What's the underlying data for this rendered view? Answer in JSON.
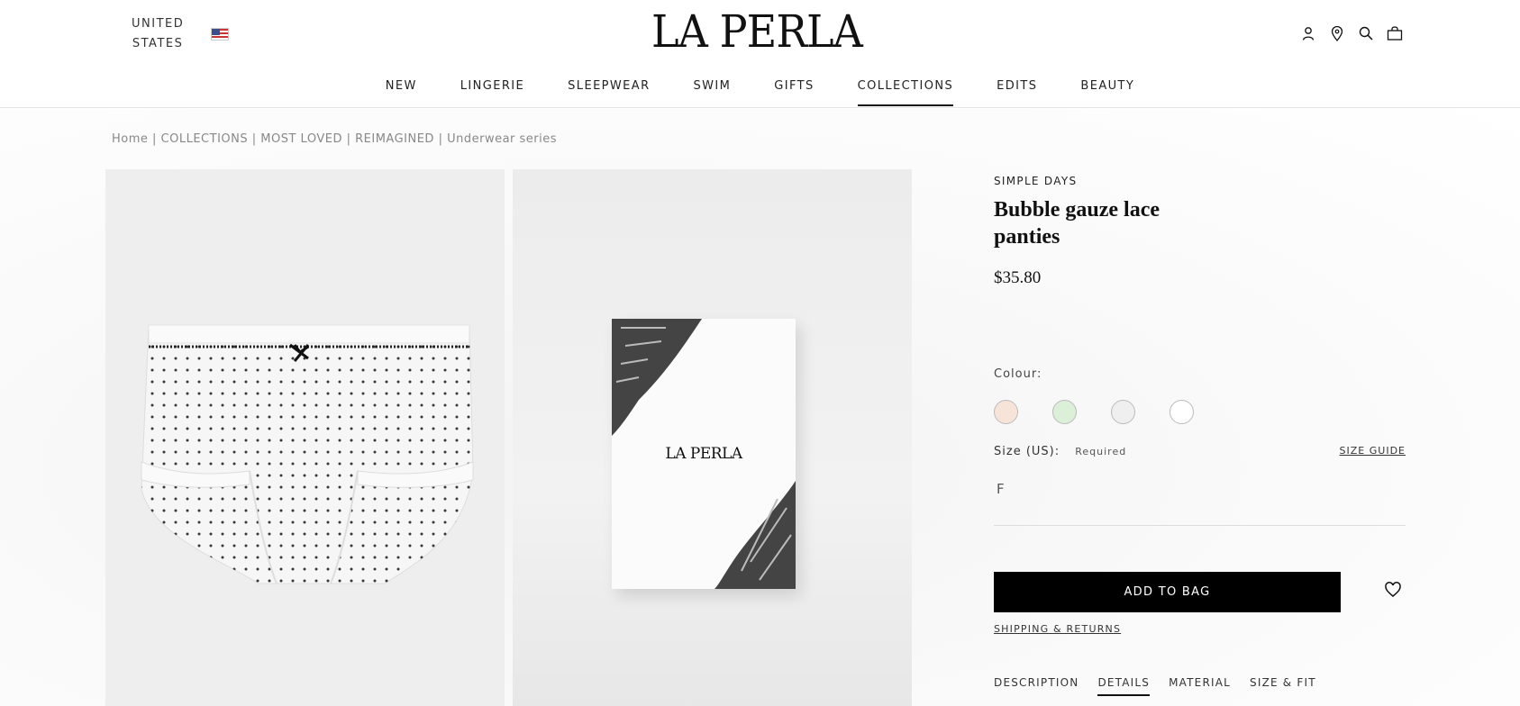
{
  "header": {
    "region_line1": "UNITED",
    "region_line2": "STATES",
    "logo": "LA PERLA",
    "icons": [
      "account-icon",
      "store-locator-icon",
      "search-icon",
      "bag-icon"
    ]
  },
  "nav": {
    "items": [
      "NEW",
      "LINGERIE",
      "SLEEPWEAR",
      "SWIM",
      "GIFTS",
      "COLLECTIONS",
      "EDITS",
      "BEAUTY"
    ],
    "active": "COLLECTIONS"
  },
  "breadcrumb": {
    "home": "Home",
    "sep": " | ",
    "collections": "COLLECTIONS",
    "most_loved": "MOST LOVED",
    "reimagined": "REIMAGINED",
    "series": "Underwear series"
  },
  "gallery": {
    "box_logo": "LA PERLA"
  },
  "product": {
    "brand": "SIMPLE DAYS",
    "title": "Bubble gauze lace panties",
    "price": "$35.80",
    "colour_label": "Colour:",
    "swatch_colors": [
      "#f7e4d8",
      "#dcefd9",
      "#efefef",
      "#ffffff"
    ],
    "size_label": "Size (US):",
    "size_required": "Required",
    "size_guide": "SIZE GUIDE",
    "size_option": "F",
    "add_to_bag": "ADD TO BAG",
    "shipping_returns": "SHIPPING & RETURNS",
    "tabs": [
      "DESCRIPTION",
      "DETAILS",
      "MATERIAL",
      "SIZE & FIT"
    ],
    "active_tab": "DETAILS"
  }
}
